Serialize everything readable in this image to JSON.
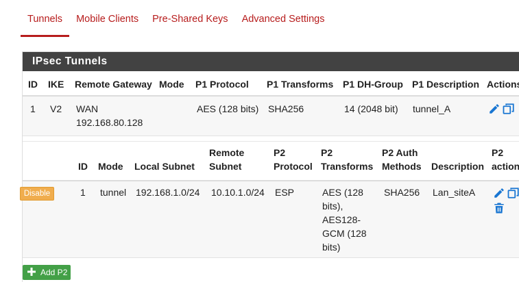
{
  "tabs": [
    {
      "label": "Tunnels",
      "active": true
    },
    {
      "label": "Mobile Clients",
      "active": false
    },
    {
      "label": "Pre-Shared Keys",
      "active": false
    },
    {
      "label": "Advanced Settings",
      "active": false
    }
  ],
  "panel": {
    "title": "IPsec Tunnels",
    "p1_headers": {
      "id": "ID",
      "ike": "IKE",
      "remote_gateway": "Remote Gateway",
      "mode": "Mode",
      "protocol": "P1 Protocol",
      "transforms": "P1 Transforms",
      "dh_group": "P1 DH-Group",
      "description": "P1 Description",
      "actions": "Actions"
    },
    "p1_row": {
      "id": "1",
      "ike": "V2",
      "remote_gateway_line1": "WAN",
      "remote_gateway_line2": "192.168.80.128",
      "mode": "",
      "protocol": "AES (128 bits)",
      "transforms": "SHA256",
      "dh_group": "14 (2048 bit)",
      "description": "tunnel_A"
    },
    "p2_headers": {
      "id": "ID",
      "mode": "Mode",
      "local_subnet": "Local Subnet",
      "remote_subnet_l1": "Remote",
      "remote_subnet_l2": "Subnet",
      "protocol_l1": "P2",
      "protocol_l2": "Protocol",
      "transforms_l1": "P2",
      "transforms_l2": "Transforms",
      "auth_l1": "P2 Auth",
      "auth_l2": "Methods",
      "description": "Description",
      "actions_l1": "P2",
      "actions_l2": "actions"
    },
    "p2_row": {
      "disable_label": "Disable",
      "id": "1",
      "mode": "tunnel",
      "local_subnet": "192.168.1.0/24",
      "remote_subnet": "10.10.1.0/24",
      "protocol": "ESP",
      "transforms_lines": [
        "AES (128",
        "bits),",
        "AES128-",
        "GCM (128",
        "bits)"
      ],
      "auth": "SHA256",
      "description": "Lan_siteA"
    },
    "add_p2_label": "Add P2"
  },
  "colors": {
    "accent": "#b71c1c",
    "heading_bg": "#424242",
    "icon": "#1976d2",
    "disable": "#f0ad4e",
    "add": "#43a047"
  },
  "icons": {
    "edit": "pencil-icon",
    "copy": "copy-icon",
    "delete": "trash-icon",
    "add": "plus-icon"
  }
}
